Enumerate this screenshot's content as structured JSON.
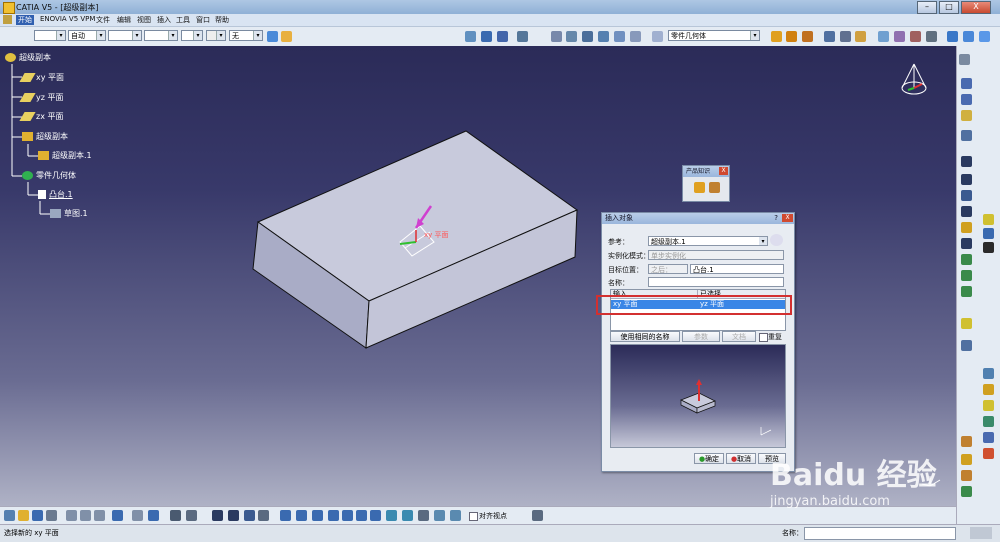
{
  "window": {
    "title": "CATIA V5 - [超级副本]",
    "min_label": "–",
    "max_label": "□",
    "close_label": "X"
  },
  "menu": {
    "start": "开始",
    "enovia": "ENOVIA V5 VPM",
    "file": "文件",
    "edit": "编辑",
    "view": "视图",
    "insert": "插入",
    "tools": "工具",
    "window": "窗口",
    "help": "帮助"
  },
  "toolbar": {
    "line_weight": "自动",
    "layer": "无",
    "workbench_combo": "零件几何体"
  },
  "tree": {
    "root": "超级副本",
    "xy": "xy 平面",
    "yz": "yz 平面",
    "zx": "zx 平面",
    "super_copy": "超级副本",
    "super_copy_1": "超级副本.1",
    "body": "零件几何体",
    "pad": "凸台.1",
    "sketch": "草图.1"
  },
  "viewport": {
    "plane_label": "xy 平面"
  },
  "product_panel": {
    "title": "产品知识"
  },
  "dialog": {
    "title": "插入对象",
    "help_btn": "?",
    "close_btn": "X",
    "ref_label": "参考：",
    "ref_value": "超级副本.1",
    "mode_label": "实例化模式：",
    "mode_value": "单步实例化",
    "target_label": "目标位置：",
    "target_after": "之后：",
    "target_value": "凸台.1",
    "name_label": "名称：",
    "name_value": "",
    "col_input": "输入",
    "col_selected": "已选择",
    "row_input": "xy 平面",
    "row_selected": "yz 平面",
    "use_same_name": "使用相同的名称",
    "btn_params": "参数",
    "btn_docs": "文档",
    "repeat_label": "重复",
    "ok": "确定",
    "cancel": "取消",
    "preview": "预览"
  },
  "bottom": {
    "align_label": "对齐视点"
  },
  "status": {
    "prompt": "选择新的 xy 平面",
    "name_label": "名称："
  },
  "watermark": {
    "text": "Baidu 经验",
    "url": "jingyan.baidu.com"
  },
  "colors": {
    "highlight_box": "#d33030",
    "selected_row": "#3a86e6",
    "tree_text": "#ffffff"
  }
}
